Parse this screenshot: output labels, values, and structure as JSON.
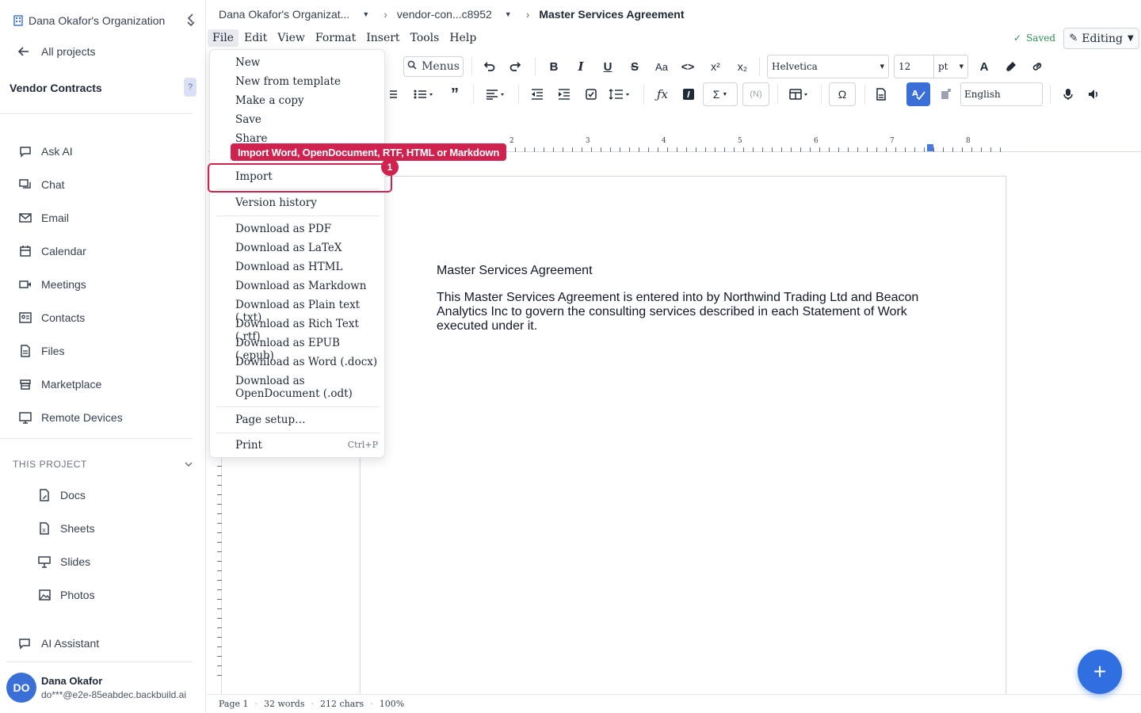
{
  "sidebar": {
    "org_name": "Dana Okafor's Organization",
    "back_label": "All projects",
    "project_name": "Vendor Contracts",
    "help_label": "?",
    "nav": [
      {
        "label": "Ask AI",
        "icon": "chat-bubble-icon"
      },
      {
        "label": "Chat",
        "icon": "chat-icon"
      },
      {
        "label": "Email",
        "icon": "mail-icon"
      },
      {
        "label": "Calendar",
        "icon": "calendar-icon"
      },
      {
        "label": "Meetings",
        "icon": "video-icon"
      },
      {
        "label": "Contacts",
        "icon": "contact-card-icon"
      },
      {
        "label": "Files",
        "icon": "file-icon"
      },
      {
        "label": "Marketplace",
        "icon": "store-icon"
      },
      {
        "label": "Remote Devices",
        "icon": "monitor-icon"
      }
    ],
    "section_title": "THIS PROJECT",
    "project_nav": [
      {
        "label": "Docs",
        "icon": "doc-icon"
      },
      {
        "label": "Sheets",
        "icon": "sheet-icon"
      },
      {
        "label": "Slides",
        "icon": "presentation-icon"
      },
      {
        "label": "Photos",
        "icon": "photo-icon"
      }
    ],
    "ai_assistant_label": "AI Assistant",
    "user": {
      "initials": "DO",
      "name": "Dana Okafor",
      "email": "do***@e2e-85eabdec.backbuild.ai"
    }
  },
  "breadcrumb": {
    "org": "Dana Okafor's Organizat...",
    "folder": "vendor-con...c8952",
    "current": "Master Services Agreement"
  },
  "menubar": {
    "items": [
      "File",
      "Edit",
      "View",
      "Format",
      "Insert",
      "Tools",
      "Help"
    ],
    "saved_label": "Saved",
    "editing_label": "Editing"
  },
  "toolbar": {
    "menus_label": "Menus",
    "font_family": "Helvetica",
    "font_size": "12",
    "font_unit": "pt",
    "language": "English",
    "omega": "Ω",
    "sigma": "Σ",
    "n_label": "(N)"
  },
  "ruler": {
    "numbers": [
      "2",
      "3",
      "4",
      "5",
      "6",
      "7",
      "8"
    ]
  },
  "file_menu": {
    "items": [
      "New",
      "New from template",
      "Make a copy",
      "Save",
      "Share",
      "Import",
      "Version history",
      "Download as PDF",
      "Download as LaTeX",
      "Download as HTML",
      "Download as Markdown",
      "Download as Plain text (.txt)",
      "Download as Rich Text (.rtf)",
      "Download as EPUB (.epub)",
      "Download as Word (.docx)",
      "Download as OpenDocument (.odt)",
      "Page setup…",
      "Print"
    ],
    "print_shortcut": "Ctrl+P"
  },
  "annotation": {
    "number": "1",
    "tooltip": "Import Word, OpenDocument, RTF, HTML or Markdown"
  },
  "document": {
    "title": "Master Services Agreement",
    "paragraph": "This Master Services Agreement is entered into by Northwind Trading Ltd and Beacon Analytics Inc to govern the consulting services described in each Statement of Work executed under it."
  },
  "status": {
    "page": "Page 1",
    "words": "32 words",
    "chars": "212 chars",
    "zoom": "100%"
  },
  "colors": {
    "accent": "#2f6fe0",
    "annotation": "#d0224f",
    "saved": "#2e8b57"
  }
}
